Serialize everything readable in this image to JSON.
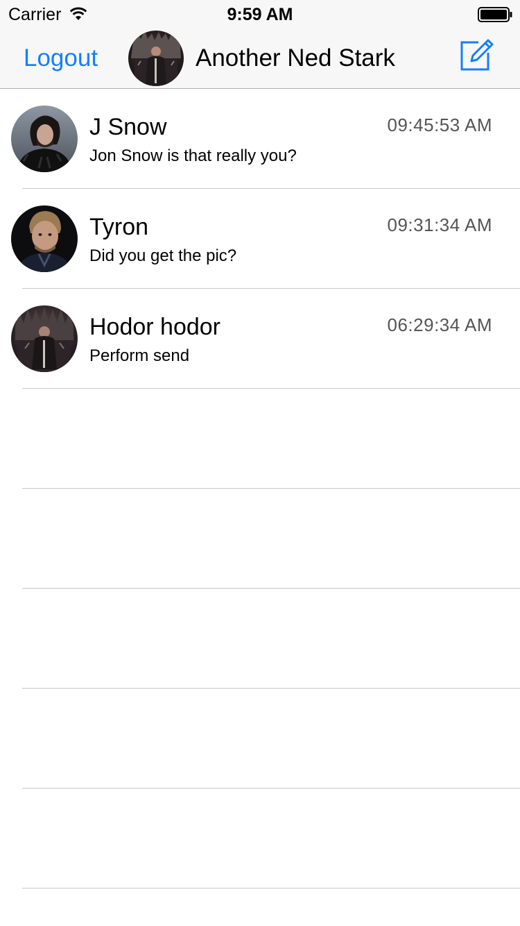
{
  "status_bar": {
    "carrier": "Carrier",
    "time": "9:59 AM",
    "icons": [
      "wifi-icon",
      "battery-icon"
    ]
  },
  "nav_bar": {
    "logout_label": "Logout",
    "title": "Another Ned Stark",
    "compose_icon": "compose-icon",
    "accent_color": "#157efb"
  },
  "conversations": [
    {
      "name": "J Snow",
      "time": "09:45:53 AM",
      "message": "Jon Snow is that really you?",
      "avatar": "portrait-jon-snow"
    },
    {
      "name": "Tyron",
      "time": "09:31:34 AM",
      "message": "Did you get the pic?",
      "avatar": "portrait-tyrion"
    },
    {
      "name": "Hodor hodor",
      "time": "06:29:34 AM",
      "message": "Perform send",
      "avatar": "portrait-iron-throne"
    }
  ]
}
